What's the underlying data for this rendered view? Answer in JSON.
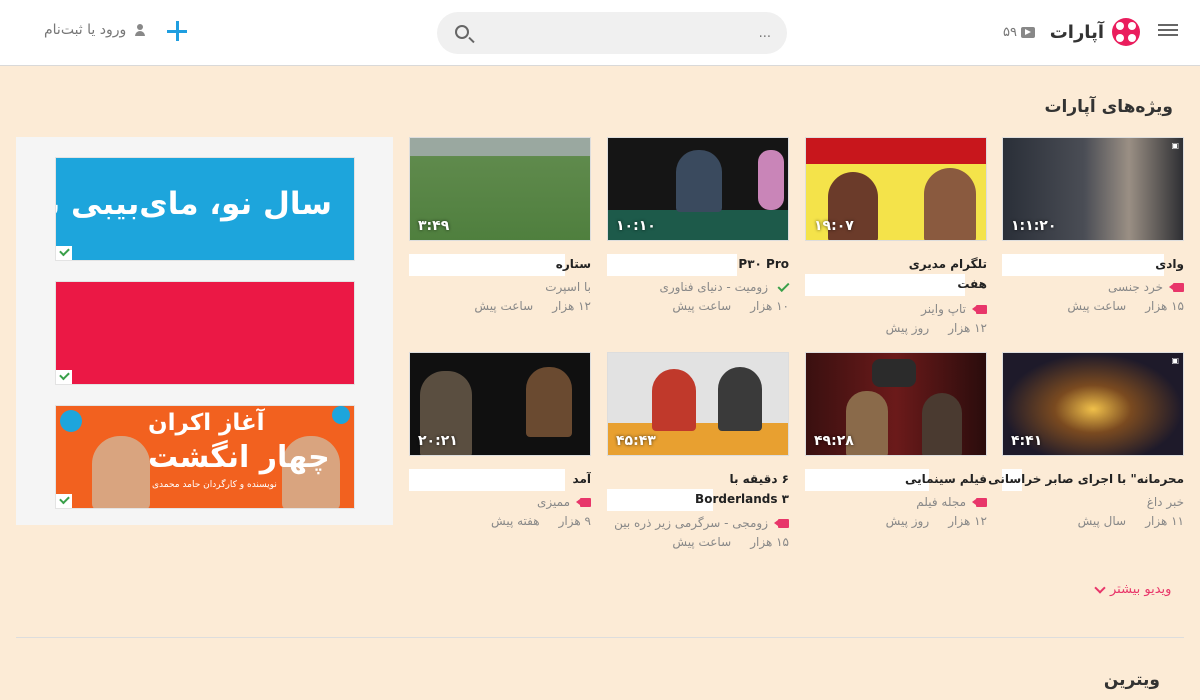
{
  "header": {
    "logo_text": "آپارات",
    "credits": "۵۹",
    "search_placeholder": "...",
    "login_label": "ورود یا ثبت‌نام"
  },
  "featured": {
    "title": "ویژه‌های آپارات",
    "more_label": "ویدیو بیشتر"
  },
  "ads": {
    "ad1_text": "سال نو، مای‌بیبی نو",
    "ad3_line1": "آغاز اکران",
    "ad3_line2": "چهار انگشت",
    "ad3_sub": "نویسنده و کارگردان حامد محمدی"
  },
  "videos": [
    {
      "title": "وادی",
      "channel": "خرد جنسی",
      "channel_type": "camera",
      "views": "۱۵ هزار",
      "age": "ساعت پیش",
      "duration": "۱:۱:۲۰"
    },
    {
      "title": "تلگرام مدیری",
      "title2": "هفت",
      "channel": "تاپ واینر",
      "channel_type": "camera",
      "views": "۱۲ هزار",
      "age": "روز پیش",
      "duration": "۱۹:۰۷"
    },
    {
      "title": "P۳۰ Pro",
      "channel": "زومیت - دنیای فناوری",
      "channel_type": "check",
      "views": "۱۰ هزار",
      "age": "ساعت پیش",
      "duration": "۱۰:۱۰"
    },
    {
      "title": "ستاره",
      "channel": "با اسپرت",
      "channel_type": "none",
      "views": "۱۲ هزار",
      "age": "ساعت پیش",
      "duration": "۳:۴۹"
    },
    {
      "title": "محرمانه\" با اجرای صابر خراسانی",
      "channel": "خبر داغ",
      "channel_type": "none",
      "views": "۱۱ هزار",
      "age": "سال پیش",
      "duration": "۴:۴۱"
    },
    {
      "title": "فیلم سینمایی",
      "channel": "مجله فیلم",
      "channel_type": "camera",
      "views": "۱۲ هزار",
      "age": "روز پیش",
      "duration": "۴۹:۲۸"
    },
    {
      "title": "۶ دقیقه با",
      "title2": "Borderlands ۳",
      "channel": "زومجی - سرگرمی زیر ذره بین",
      "channel_type": "camera",
      "views": "۱۵ هزار",
      "age": "ساعت پیش",
      "duration": "۴۵:۴۳"
    },
    {
      "title": "آمد",
      "channel": "ممیزی",
      "channel_type": "camera",
      "views": "۹ هزار",
      "age": "هفته پیش",
      "duration": "۲۰:۲۱"
    }
  ],
  "vitrine": {
    "title": "ویترین"
  },
  "colors": {
    "background": "#fcebd6",
    "accent": "#e8366a",
    "brand": "#ea1d5d",
    "plus": "#1f9ee0"
  }
}
